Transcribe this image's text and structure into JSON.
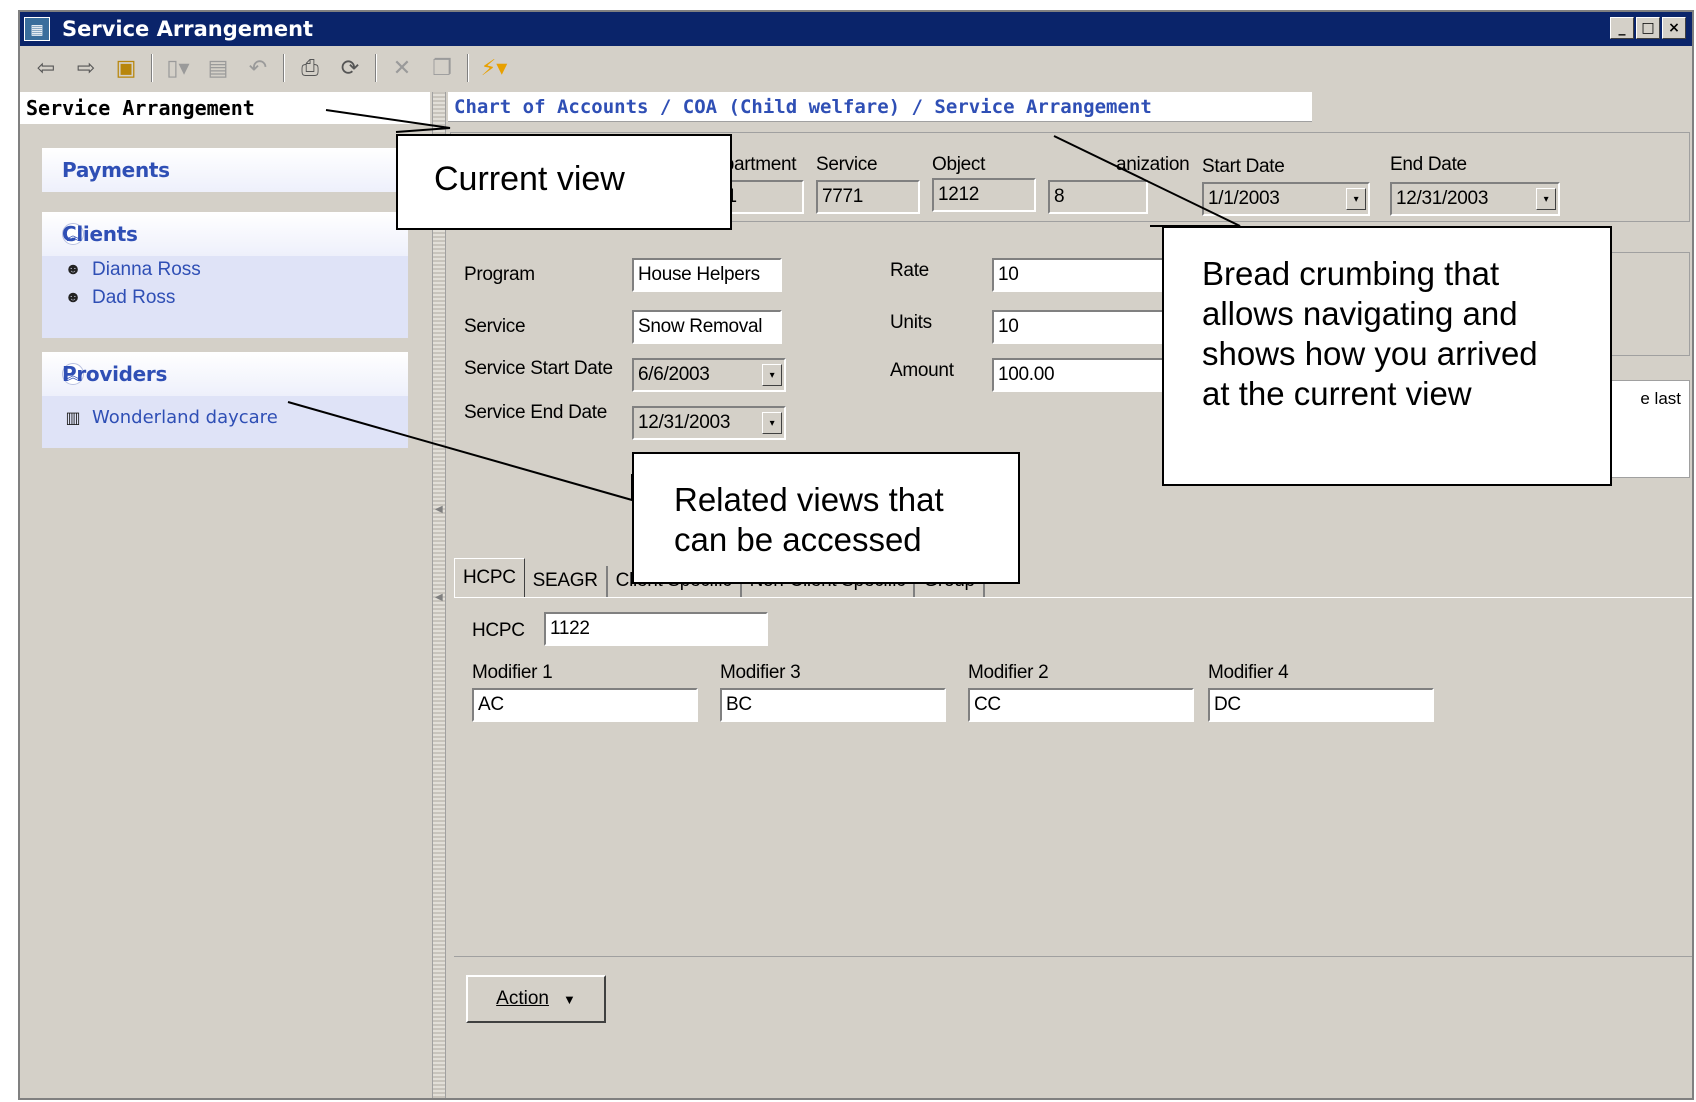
{
  "window": {
    "title": "Service Arrangement",
    "controls": [
      "_",
      "□",
      "×"
    ]
  },
  "toolbar": {
    "buttons": [
      {
        "icon": "back-arrow-icon",
        "glyph": "⇦"
      },
      {
        "icon": "forward-arrow-icon",
        "glyph": "⇨"
      },
      {
        "icon": "up-folder-icon",
        "glyph": "▣"
      },
      {
        "icon": "new-document-icon",
        "glyph": "▯▾"
      },
      {
        "icon": "save-icon",
        "glyph": "▤"
      },
      {
        "icon": "undo-icon",
        "glyph": "↶"
      },
      {
        "icon": "print-icon",
        "glyph": "⎙"
      },
      {
        "icon": "refresh-icon",
        "glyph": "⟳"
      },
      {
        "icon": "delete-icon",
        "glyph": "✕"
      },
      {
        "icon": "copy-icon",
        "glyph": "❐"
      },
      {
        "icon": "actions-lightning-icon",
        "glyph": "⚡▾"
      }
    ]
  },
  "left": {
    "current_view": "Service Arrangement",
    "sections": {
      "payments": {
        "label": "Payments"
      },
      "clients": {
        "label": "Clients",
        "collapse": "︽",
        "items": [
          "Dianna Ross",
          "Dad Ross"
        ]
      },
      "providers": {
        "label": "Providers",
        "collapse": "︽",
        "items": [
          "Wonderland daycare"
        ]
      }
    }
  },
  "breadcrumb": "Chart of Accounts / COA (Child welfare) / Service Arrangement",
  "coa": {
    "department": {
      "label": "Department",
      "value": "001"
    },
    "service": {
      "label": "Service",
      "value": "7771"
    },
    "object": {
      "label": "Object",
      "value": "1212"
    },
    "organization": {
      "label": "Organization",
      "visible_label": "anization",
      "value": "8"
    },
    "start_date": {
      "label": "Start Date",
      "value": "1/1/2003"
    },
    "end_date": {
      "label": "End Date",
      "value": "12/31/2003"
    }
  },
  "form": {
    "program": {
      "label": "Program",
      "value": "House Helpers"
    },
    "service": {
      "label": "Service",
      "value": "Snow Removal"
    },
    "service_start_date": {
      "label": "Service Start Date",
      "value": "6/6/2003"
    },
    "service_end_date": {
      "label": "Service End Date",
      "value": "12/31/2003"
    },
    "rate": {
      "label": "Rate",
      "value": "10"
    },
    "units": {
      "label": "Units",
      "value": "10"
    },
    "amount": {
      "label": "Amount",
      "value": "100.00"
    },
    "notes_fragment": "e last"
  },
  "tabs": [
    "HCPC",
    "SEAGR",
    "Client Specific",
    "Non-Client Specific",
    "Group"
  ],
  "hcpc": {
    "label": "HCPC",
    "value": "1122",
    "modifiers": [
      {
        "label": "Modifier 1",
        "value": "AC"
      },
      {
        "label": "Modifier 3",
        "value": "BC"
      },
      {
        "label": "Modifier 2",
        "value": "CC"
      },
      {
        "label": "Modifier 4",
        "value": "DC"
      }
    ]
  },
  "action": {
    "label": "Action",
    "caret": "▼"
  },
  "dropdown_glyph": "▾",
  "callouts": {
    "current_view": "Current view",
    "breadcrumb": [
      "Bread crumbing that",
      "allows navigating and",
      "shows how you arrived",
      "at the current view"
    ],
    "related": [
      "Related views that",
      "can be accessed"
    ]
  },
  "colors": {
    "titlebar": "#0a246a",
    "link_blue": "#2f4fb5",
    "chrome": "#d4d0c8"
  }
}
